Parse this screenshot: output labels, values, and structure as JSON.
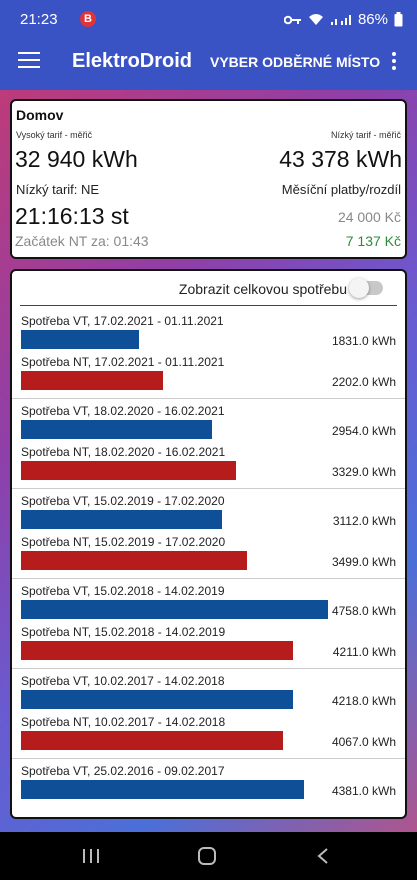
{
  "status": {
    "time": "21:23",
    "badge": "B",
    "battery": "86%"
  },
  "appbar": {
    "title": "ElektroDroid",
    "select_label": "VYBER ODBĚRNÉ MÍSTO"
  },
  "meter": {
    "place": "Domov",
    "vt_label": "Vysoký tarif - měřič",
    "nt_label": "Nízký tarif - měřič",
    "vt_value": "32 940 kWh",
    "nt_value": "43 378 kWh",
    "nt_status": "Nízký tarif: NE",
    "payments_label": "Měsíční platby/rozdíl",
    "clock": "21:16:13 st",
    "payments_value": "24 000 Kč",
    "nt_start": "Začátek NT za: 01:43",
    "difference_value": "7 137 Kč"
  },
  "consumption": {
    "toggle_label": "Zobrazit celkovou spotřebu",
    "vt_color": "#0e4f97",
    "nt_color": "#b71c1c",
    "max_value": 4758,
    "rows": [
      {
        "label": "Spotřeba VT, 17.02.2021 - 01.11.2021",
        "value": 1831.0,
        "value_text": "1831.0 kWh",
        "kind": "vt"
      },
      {
        "label": "Spotřeba NT, 17.02.2021 - 01.11.2021",
        "value": 2202.0,
        "value_text": "2202.0 kWh",
        "kind": "nt"
      },
      {
        "label": "Spotřeba VT, 18.02.2020 - 16.02.2021",
        "value": 2954.0,
        "value_text": "2954.0 kWh",
        "kind": "vt"
      },
      {
        "label": "Spotřeba NT, 18.02.2020 - 16.02.2021",
        "value": 3329.0,
        "value_text": "3329.0 kWh",
        "kind": "nt"
      },
      {
        "label": "Spotřeba VT, 15.02.2019 - 17.02.2020",
        "value": 3112.0,
        "value_text": "3112.0 kWh",
        "kind": "vt"
      },
      {
        "label": "Spotřeba NT, 15.02.2019 - 17.02.2020",
        "value": 3499.0,
        "value_text": "3499.0 kWh",
        "kind": "nt"
      },
      {
        "label": "Spotřeba VT, 15.02.2018 - 14.02.2019",
        "value": 4758.0,
        "value_text": "4758.0 kWh",
        "kind": "vt"
      },
      {
        "label": "Spotřeba NT, 15.02.2018 - 14.02.2019",
        "value": 4211.0,
        "value_text": "4211.0 kWh",
        "kind": "nt"
      },
      {
        "label": "Spotřeba VT, 10.02.2017 - 14.02.2018",
        "value": 4218.0,
        "value_text": "4218.0 kWh",
        "kind": "vt"
      },
      {
        "label": "Spotřeba NT, 10.02.2017 - 14.02.2018",
        "value": 4067.0,
        "value_text": "4067.0 kWh",
        "kind": "nt"
      },
      {
        "label": "Spotřeba VT, 25.02.2016 - 09.02.2017",
        "value": 4381.0,
        "value_text": "4381.0 kWh",
        "kind": "vt"
      }
    ]
  }
}
